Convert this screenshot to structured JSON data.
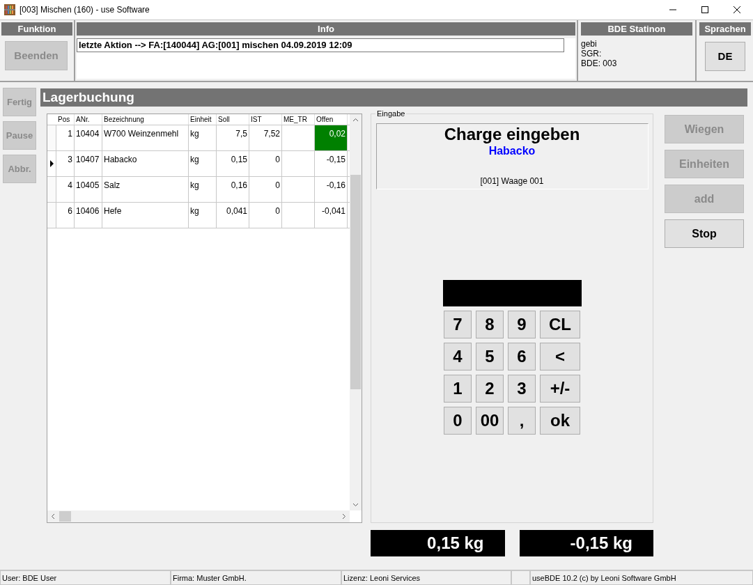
{
  "window": {
    "title": "[003] Mischen (160) - use Software"
  },
  "funktion": {
    "title": "Funktion",
    "button": {
      "label": "Beenden",
      "disabled": true
    }
  },
  "info": {
    "title": "Info",
    "message": "letzte Aktion --> FA:[140044] AG:[001] mischen 04.09.2019 12:09"
  },
  "station": {
    "title": "BDE Statinon",
    "lines": [
      "gebi",
      "SGR:",
      "BDE: 003"
    ]
  },
  "sprachen": {
    "title": "Sprachen",
    "button": {
      "label": "DE",
      "disabled": false
    }
  },
  "side_buttons": [
    {
      "label": "Fertig",
      "disabled": true
    },
    {
      "label": "Pause",
      "disabled": true
    },
    {
      "label": "Abbr.",
      "disabled": true
    }
  ],
  "section_title": "Lagerbuchung",
  "table": {
    "columns": [
      "Pos",
      "ANr.",
      "Bezeichnung",
      "Einheit",
      "Soll",
      "IST",
      "ME_TR",
      "Offen"
    ],
    "rows": [
      {
        "selected": false,
        "cells": [
          "1",
          "10404",
          "W700 Weinzenmehl",
          "kg",
          "7,5",
          "7,52",
          "",
          "0,02"
        ],
        "offen_done": true
      },
      {
        "selected": true,
        "cells": [
          "3",
          "10407",
          "Habacko",
          "kg",
          "0,15",
          "0",
          "",
          "-0,15"
        ],
        "offen_done": false
      },
      {
        "selected": false,
        "cells": [
          "4",
          "10405",
          "Salz",
          "kg",
          "0,16",
          "0",
          "",
          "-0,16"
        ],
        "offen_done": false
      },
      {
        "selected": false,
        "cells": [
          "6",
          "10406",
          "Hefe",
          "kg",
          "0,041",
          "0",
          "",
          "-0,041"
        ],
        "offen_done": false
      }
    ]
  },
  "eingabe": {
    "title": "Eingabe",
    "heading": "Charge eingeben",
    "article": "Habacko",
    "scale": "[001] Waage 001",
    "keypad": [
      "7",
      "8",
      "9",
      "CL",
      "4",
      "5",
      "6",
      "<",
      "1",
      "2",
      "3",
      "+/-",
      "0",
      "00",
      ",",
      "ok"
    ]
  },
  "right_buttons": [
    {
      "label": "Wiegen",
      "disabled": true
    },
    {
      "label": "Einheiten",
      "disabled": true
    },
    {
      "label": "add",
      "disabled": true
    },
    {
      "label": "Stop",
      "disabled": false
    }
  ],
  "readouts": [
    "0,15 kg",
    "-0,15 kg"
  ],
  "status_bar": [
    "User: BDE User",
    "Firma: Muster GmbH.",
    "Lizenz: Leoni Services",
    "useBDE 10.2 (c) by Leoni Software GmbH"
  ]
}
